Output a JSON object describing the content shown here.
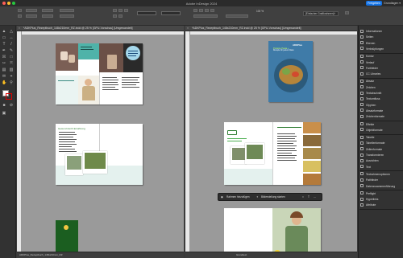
{
  "app": {
    "title": "Adobe InDesign 2024",
    "share_label": "Freigeben",
    "workspace_label": "Grundlagen",
    "zoom_percent": "100 %",
    "style_dropdown": "[Einfacher Grafikrahmen]+"
  },
  "documents": [
    {
      "tab_label": "*ADKPlus_Rezeptbuch_148x210mm_RZ.indd @ 25 % [GPU-Vorschau] [Umgewandelt]",
      "status_text": "ADKPlus_Rezeptbuch_148x210mm_RZ"
    },
    {
      "tab_label": "*ADKPlus_Rezeptbuch_148x210mm_RZ.indd @ 25 % [GPU-Vorschau] [Umgewandelt]",
      "status_text": "Grundtext"
    }
  ],
  "context_toolbar": {
    "place_frame_label": "Rahmen hinzufügen",
    "generate_label": "Bilderstellung starten"
  },
  "cover": {
    "brand": "ADKPlus",
    "title_line1": "Proteine Pasta +",
    "title_line2": "Rezepte für jeden Anlass"
  },
  "spread_heading": "Gesund durch Ernährung",
  "panels": [
    {
      "icon": "info-icon",
      "label": "Informationen"
    },
    {
      "icon": "pages-icon",
      "label": "Seiten"
    },
    {
      "icon": "layers-icon",
      "label": "Ebenen"
    },
    {
      "icon": "links-icon",
      "label": "Verknüpfungen"
    },
    {
      "icon": "stroke-icon",
      "label": "Kontur"
    },
    {
      "icon": "gradient-icon",
      "label": "Verlauf"
    },
    {
      "icon": "swatches-icon",
      "label": "Farbfelder"
    },
    {
      "icon": "cc-libraries-icon",
      "label": "CC Libraries"
    },
    {
      "icon": "character-icon",
      "label": "Absatz"
    },
    {
      "icon": "paragraph-icon",
      "label": "Zeichen"
    },
    {
      "icon": "paragraph-styles-icon",
      "label": "Textabschnitt"
    },
    {
      "icon": "textframe-icon",
      "label": "Textumfluss"
    },
    {
      "icon": "glyphs-icon",
      "label": "Glyphen"
    },
    {
      "icon": "paragraph-formats-icon",
      "label": "Absatzformate"
    },
    {
      "icon": "char-formats-icon",
      "label": "Zeichenformate"
    },
    {
      "icon": "effects-icon",
      "label": "Effekte"
    },
    {
      "icon": "object-formats-icon",
      "label": "Objektformate"
    },
    {
      "icon": "tables-icon",
      "label": "Tabelle"
    },
    {
      "icon": "table-formats-icon",
      "label": "Tabellenformate"
    },
    {
      "icon": "cell-formats-icon",
      "label": "Zellenformate"
    },
    {
      "icon": "transform-icon",
      "label": "Transformieren"
    },
    {
      "icon": "align-icon",
      "label": "Ausrichten"
    },
    {
      "icon": "text-icon",
      "label": "Text"
    },
    {
      "icon": "text-frame-icon",
      "label": "Textrahmenoptionen"
    },
    {
      "icon": "pathfinder-icon",
      "label": "Pathfinder"
    },
    {
      "icon": "variables-icon",
      "label": "Datenzusammenführung"
    },
    {
      "icon": "preflight-icon",
      "label": "Preflight"
    },
    {
      "icon": "hyperlinks-icon",
      "label": "Hyperlinks"
    },
    {
      "icon": "attributes-icon",
      "label": "Attribute"
    }
  ],
  "colors": {
    "accent": "#1473e6",
    "teal": "#4fb3a9",
    "green": "#2e7d32",
    "dark_green": "#1b5e20"
  }
}
